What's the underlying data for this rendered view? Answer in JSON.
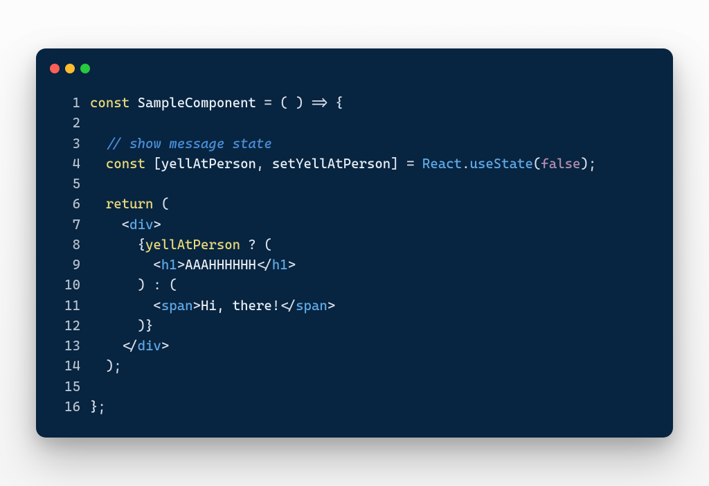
{
  "window": {
    "traffic_lights": [
      "red",
      "yellow",
      "green"
    ]
  },
  "code": {
    "lines": [
      {
        "n": "1",
        "t": [
          {
            "c": "tok-kw",
            "s": "const"
          },
          {
            "c": "tok-var",
            "s": " SampleComponent "
          },
          {
            "c": "tok-punc",
            "s": "= ( ) "
          },
          {
            "c": "tok-punc",
            "s": "=> {"
          }
        ]
      },
      {
        "n": "2",
        "t": []
      },
      {
        "n": "3",
        "t": [
          {
            "c": "tok-var",
            "s": "  "
          },
          {
            "c": "tok-comment",
            "s": "// show message state"
          }
        ]
      },
      {
        "n": "4",
        "t": [
          {
            "c": "tok-var",
            "s": "  "
          },
          {
            "c": "tok-kw",
            "s": "const"
          },
          {
            "c": "tok-punc",
            "s": " ["
          },
          {
            "c": "tok-var",
            "s": "yellAtPerson"
          },
          {
            "c": "tok-punc",
            "s": ", "
          },
          {
            "c": "tok-var",
            "s": "setYellAtPerson"
          },
          {
            "c": "tok-punc",
            "s": "] = "
          },
          {
            "c": "tok-fn",
            "s": "React"
          },
          {
            "c": "tok-punc",
            "s": "."
          },
          {
            "c": "tok-fn",
            "s": "useState"
          },
          {
            "c": "tok-punc",
            "s": "("
          },
          {
            "c": "tok-bool",
            "s": "false"
          },
          {
            "c": "tok-punc",
            "s": ");"
          }
        ]
      },
      {
        "n": "5",
        "t": []
      },
      {
        "n": "6",
        "t": [
          {
            "c": "tok-var",
            "s": "  "
          },
          {
            "c": "tok-kw",
            "s": "return"
          },
          {
            "c": "tok-punc",
            "s": " ("
          }
        ]
      },
      {
        "n": "7",
        "t": [
          {
            "c": "tok-var",
            "s": "    "
          },
          {
            "c": "tok-punc",
            "s": "<"
          },
          {
            "c": "tok-tagname",
            "s": "div"
          },
          {
            "c": "tok-punc",
            "s": ">"
          }
        ]
      },
      {
        "n": "8",
        "t": [
          {
            "c": "tok-var",
            "s": "      "
          },
          {
            "c": "tok-punc",
            "s": "{"
          },
          {
            "c": "tok-jsx",
            "s": "yellAtPerson"
          },
          {
            "c": "tok-punc",
            "s": " ? ("
          }
        ]
      },
      {
        "n": "9",
        "t": [
          {
            "c": "tok-var",
            "s": "        "
          },
          {
            "c": "tok-punc",
            "s": "<"
          },
          {
            "c": "tok-tagname",
            "s": "h1"
          },
          {
            "c": "tok-punc",
            "s": ">"
          },
          {
            "c": "tok-text",
            "s": "AAAHHHHHH"
          },
          {
            "c": "tok-punc",
            "s": "</"
          },
          {
            "c": "tok-tagname",
            "s": "h1"
          },
          {
            "c": "tok-punc",
            "s": ">"
          }
        ]
      },
      {
        "n": "10",
        "t": [
          {
            "c": "tok-var",
            "s": "      "
          },
          {
            "c": "tok-punc",
            "s": ") : ("
          }
        ]
      },
      {
        "n": "11",
        "t": [
          {
            "c": "tok-var",
            "s": "        "
          },
          {
            "c": "tok-punc",
            "s": "<"
          },
          {
            "c": "tok-tagname",
            "s": "span"
          },
          {
            "c": "tok-punc",
            "s": ">"
          },
          {
            "c": "tok-text",
            "s": "Hi, there!"
          },
          {
            "c": "tok-punc",
            "s": "</"
          },
          {
            "c": "tok-tagname",
            "s": "span"
          },
          {
            "c": "tok-punc",
            "s": ">"
          }
        ]
      },
      {
        "n": "12",
        "t": [
          {
            "c": "tok-var",
            "s": "      "
          },
          {
            "c": "tok-punc",
            "s": ")}"
          }
        ]
      },
      {
        "n": "13",
        "t": [
          {
            "c": "tok-var",
            "s": "    "
          },
          {
            "c": "tok-punc",
            "s": "</"
          },
          {
            "c": "tok-tagname",
            "s": "div"
          },
          {
            "c": "tok-punc",
            "s": ">"
          }
        ]
      },
      {
        "n": "14",
        "t": [
          {
            "c": "tok-var",
            "s": "  "
          },
          {
            "c": "tok-punc",
            "s": ");"
          }
        ]
      },
      {
        "n": "15",
        "t": []
      },
      {
        "n": "16",
        "t": [
          {
            "c": "tok-punc",
            "s": "};"
          }
        ]
      }
    ]
  }
}
